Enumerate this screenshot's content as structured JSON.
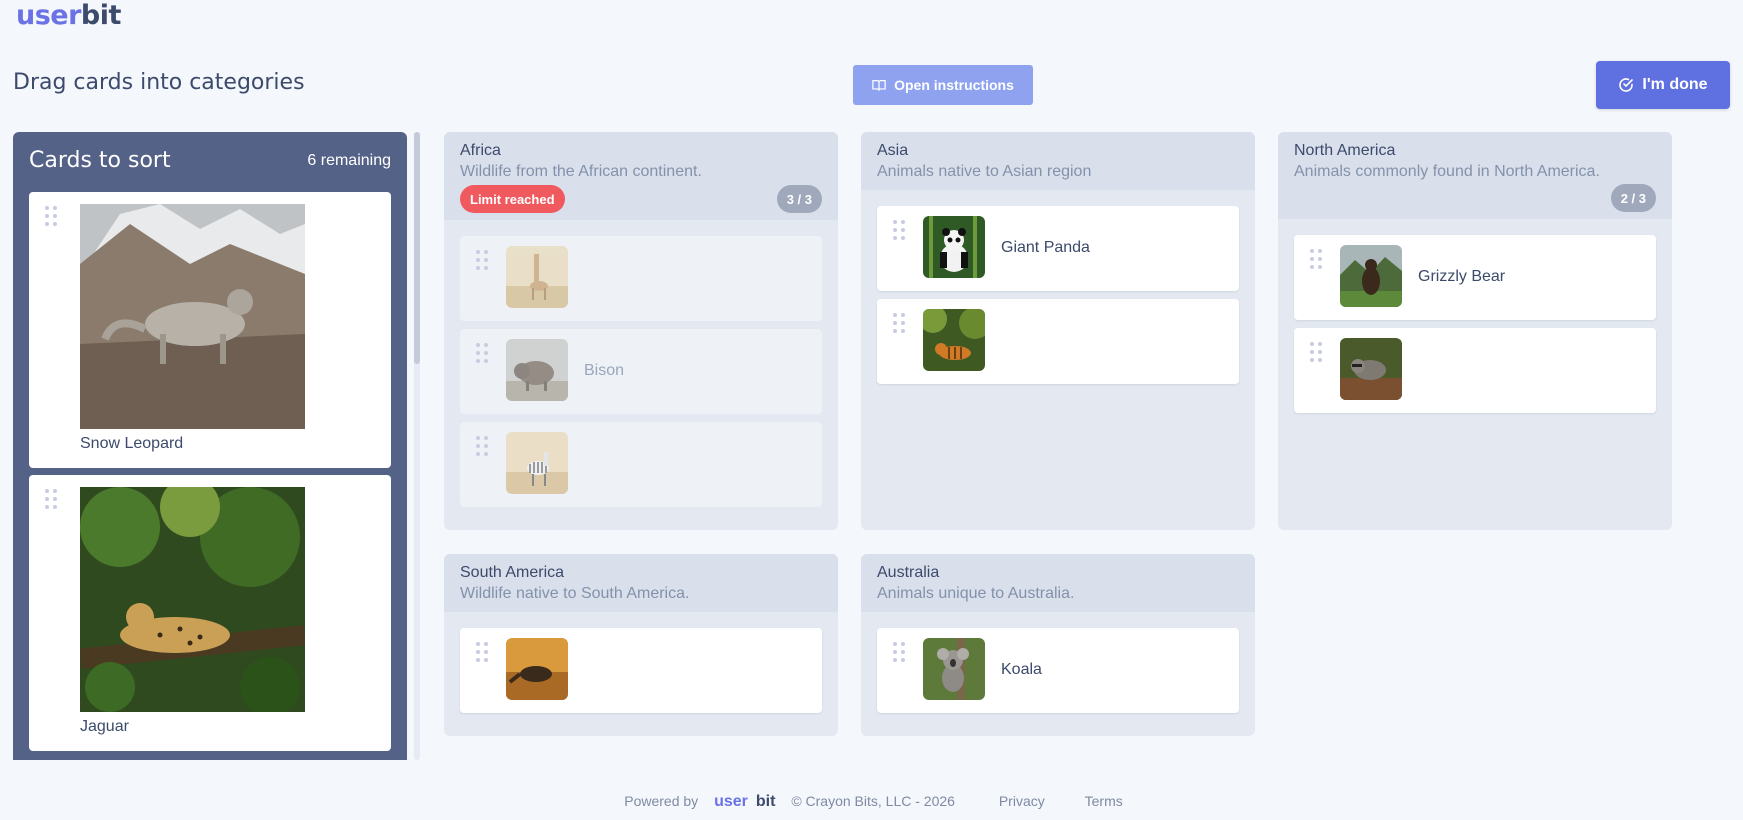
{
  "logo": {
    "part1": "user",
    "part2": "bit"
  },
  "header": {
    "title": "Drag cards into categories",
    "instructions_label": "Open instructions",
    "done_label": "I'm done"
  },
  "sort_panel": {
    "title": "Cards to sort",
    "remaining": "6 remaining",
    "cards": [
      {
        "label": "Snow Leopard"
      },
      {
        "label": "Jaguar"
      }
    ]
  },
  "categories": {
    "africa": {
      "name": "Africa",
      "desc": "Wildlife from the African continent.",
      "limit": "Limit reached",
      "count": "3 / 3",
      "cards": [
        {
          "label": ""
        },
        {
          "label": "Bison"
        },
        {
          "label": ""
        }
      ]
    },
    "asia": {
      "name": "Asia",
      "desc": "Animals native to Asian region",
      "cards": [
        {
          "label": "Giant Panda"
        },
        {
          "label": ""
        }
      ]
    },
    "north_america": {
      "name": "North America",
      "desc": "Animals commonly found in North America.",
      "count": "2 / 3",
      "cards": [
        {
          "label": "Grizzly Bear"
        },
        {
          "label": ""
        }
      ]
    },
    "south_america": {
      "name": "South America",
      "desc": "Wildlife native to South America.",
      "cards": [
        {
          "label": ""
        }
      ]
    },
    "australia": {
      "name": "Australia",
      "desc": "Animals unique to Australia.",
      "cards": [
        {
          "label": "Koala"
        }
      ]
    }
  },
  "footer": {
    "powered_by": "Powered by",
    "brand1": "user",
    "brand2": "bit",
    "copyright": "© Crayon Bits, LLC - 2026",
    "privacy": "Privacy",
    "terms": "Terms"
  },
  "colors": {
    "accent": "#5f70e0",
    "panel": "#546287",
    "limit": "#f05a5f"
  }
}
